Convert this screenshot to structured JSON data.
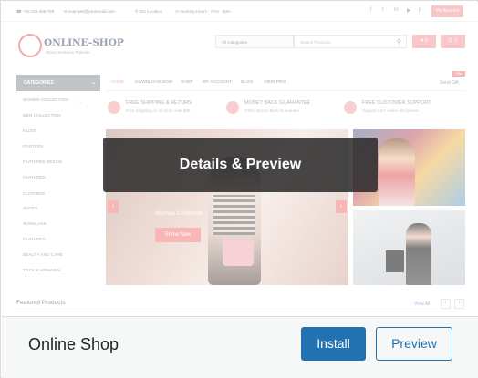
{
  "theme": {
    "name": "Online Shop",
    "overlay_label": "Details & Preview",
    "install_label": "Install",
    "preview_label": "Preview"
  },
  "screenshot": {
    "topbar": {
      "phone": "+00 123-456-789",
      "email": "example@youremail.com",
      "location": "Our Location",
      "hours": "Working Hours : 7Am - 8pm",
      "social_icons": [
        "facebook-icon",
        "twitter-icon",
        "linkedin-icon",
        "youtube-icon",
        "pinterest-icon"
      ],
      "account": "My Account"
    },
    "logo": {
      "title": "ONLINE-SHOP",
      "tagline": "WooCommerce Themes"
    },
    "search": {
      "category": "All Categories",
      "placeholder": "Search Products"
    },
    "header_buttons": {
      "wishlist_count": "0",
      "cart_count": "0"
    },
    "nav": {
      "categories_label": "CATEGORIES",
      "items": [
        "HOME",
        "DOWNLOAD NOW",
        "SHOP",
        "MY ACCOUNT",
        "BLOG",
        "VIEW PRO"
      ],
      "offer_badge": "Offer",
      "send_gift": "Send Gift"
    },
    "sidebar_items": [
      "WOMEN COLLECTION",
      "MEN COLLECTION",
      "MUSIC",
      "POSTERS",
      "FEATURED BESIDE",
      "FEATURED",
      "CLOTHING",
      "SHOES",
      "SUNGLASS",
      "FEATURED",
      "BEAUTY AND CARE",
      "TOYS & APPAREAL"
    ],
    "features": [
      {
        "title": "FREE SHIPPING & RETURN",
        "desc": "Free Shipping on all order over $99"
      },
      {
        "title": "MONEY BACK GUARANTEE",
        "desc": "100% Money Back Guarantee"
      },
      {
        "title": "FREE CUSTOMER SUPPORT",
        "desc": "Support 24/7 online and phone"
      }
    ],
    "slider": {
      "caption": "Woman Collection",
      "button": "Show Now",
      "prev": "‹",
      "next": "›"
    },
    "featured_products": {
      "title": "Featured Products",
      "view_all": "View All",
      "prev": "‹",
      "next": "›"
    }
  },
  "colors": {
    "accent": "#f28b8b",
    "wp_blue": "#2271b1",
    "overlay": "#282828"
  }
}
